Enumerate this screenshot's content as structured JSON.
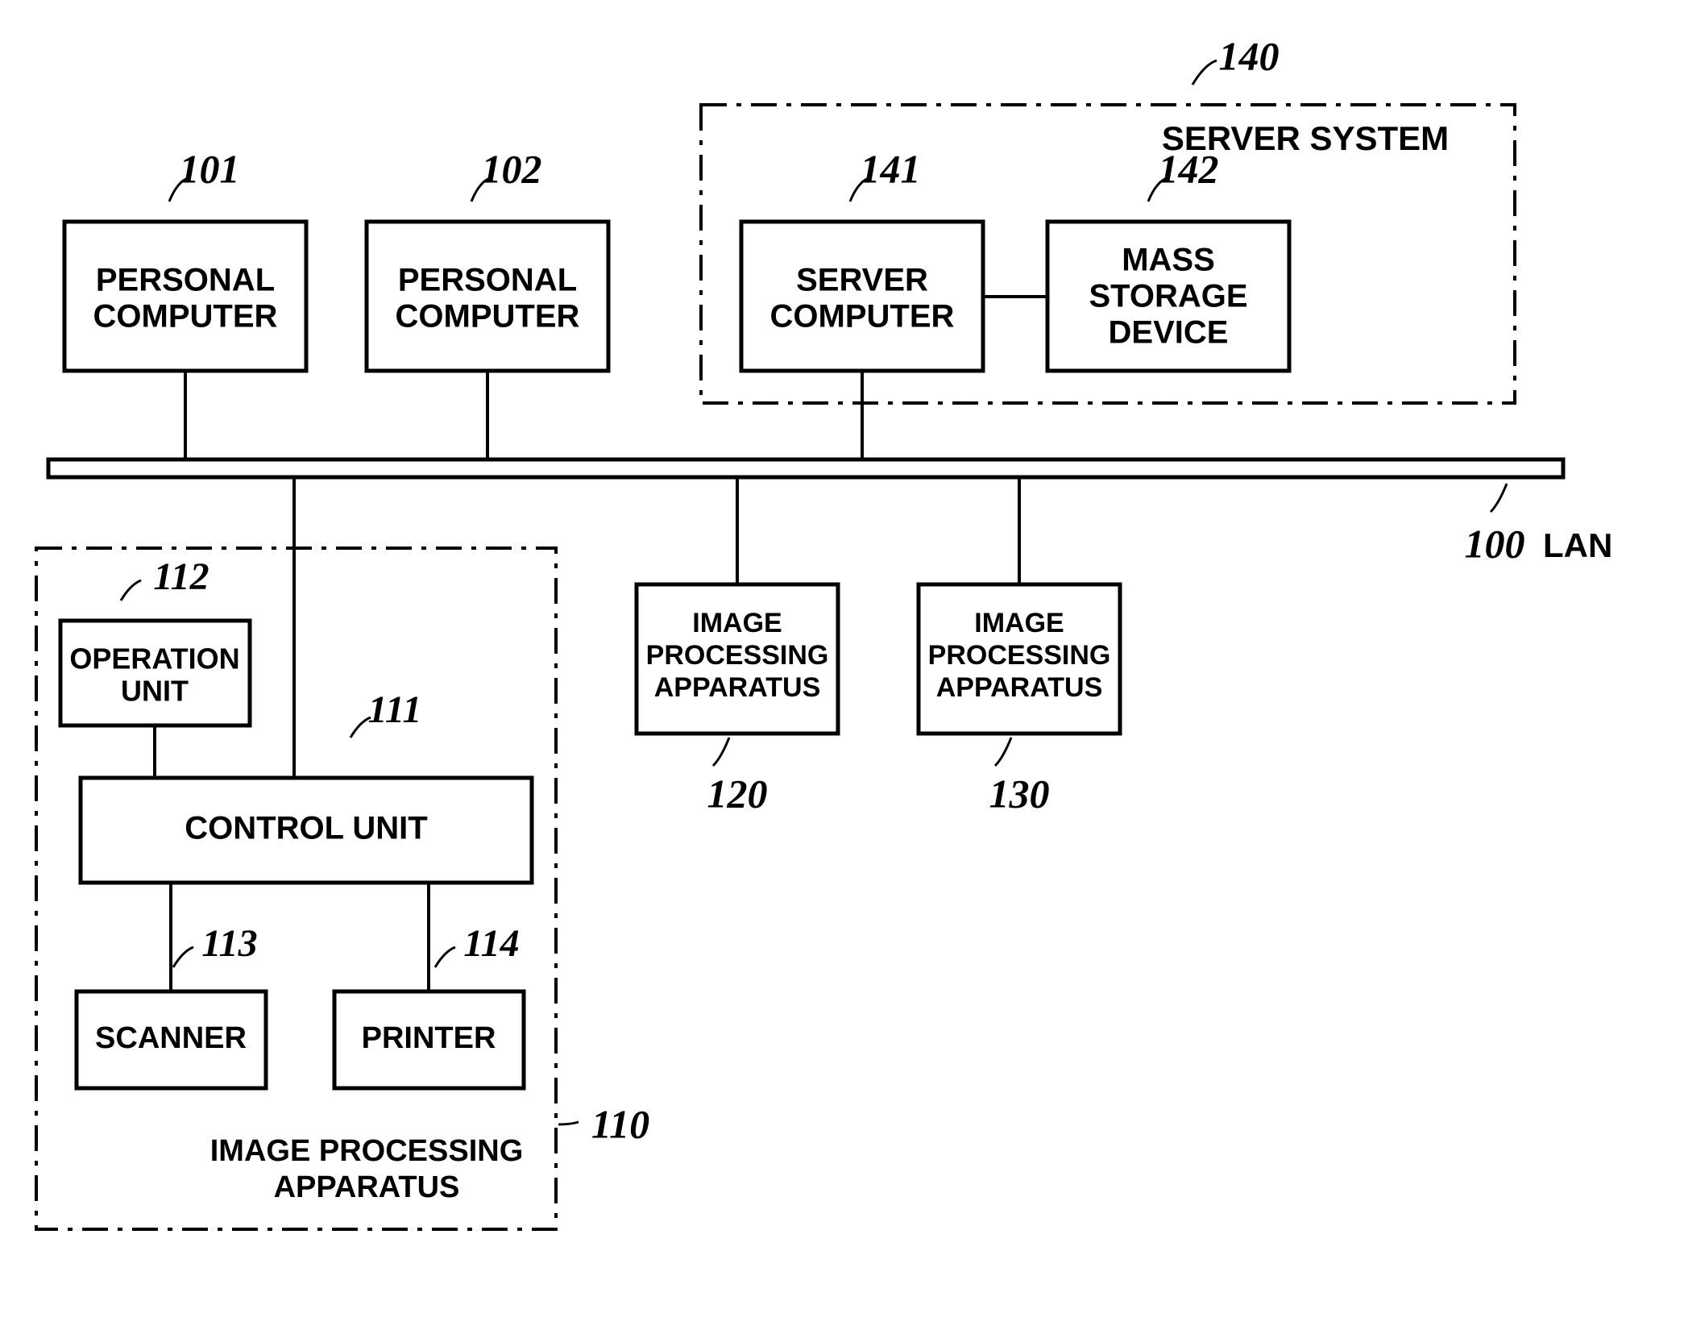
{
  "blocks": {
    "pc1": {
      "ref": "101",
      "lines": [
        "PERSONAL",
        "COMPUTER"
      ]
    },
    "pc2": {
      "ref": "102",
      "lines": [
        "PERSONAL",
        "COMPUTER"
      ]
    },
    "server": {
      "ref": "141",
      "lines": [
        "SERVER",
        "COMPUTER"
      ]
    },
    "storage": {
      "ref": "142",
      "lines": [
        "MASS",
        "STORAGE",
        "DEVICE"
      ]
    },
    "opunit": {
      "ref": "112",
      "lines": [
        "OPERATION",
        "UNIT"
      ]
    },
    "ctrl": {
      "ref": "111",
      "lines": [
        "CONTROL UNIT"
      ]
    },
    "scanner": {
      "ref": "113",
      "lines": [
        "SCANNER"
      ]
    },
    "printer": {
      "ref": "114",
      "lines": [
        "PRINTER"
      ]
    },
    "ipa2": {
      "ref": "120",
      "lines": [
        "IMAGE",
        "PROCESSING",
        "APPARATUS"
      ]
    },
    "ipa3": {
      "ref": "130",
      "lines": [
        "IMAGE",
        "PROCESSING",
        "APPARATUS"
      ]
    }
  },
  "groups": {
    "serverSystem": {
      "ref": "140",
      "label": "SERVER SYSTEM"
    },
    "ipa1": {
      "ref": "110",
      "label_lines": [
        "IMAGE PROCESSING",
        "APPARATUS"
      ]
    }
  },
  "bus": {
    "ref": "100",
    "label": "LAN"
  }
}
